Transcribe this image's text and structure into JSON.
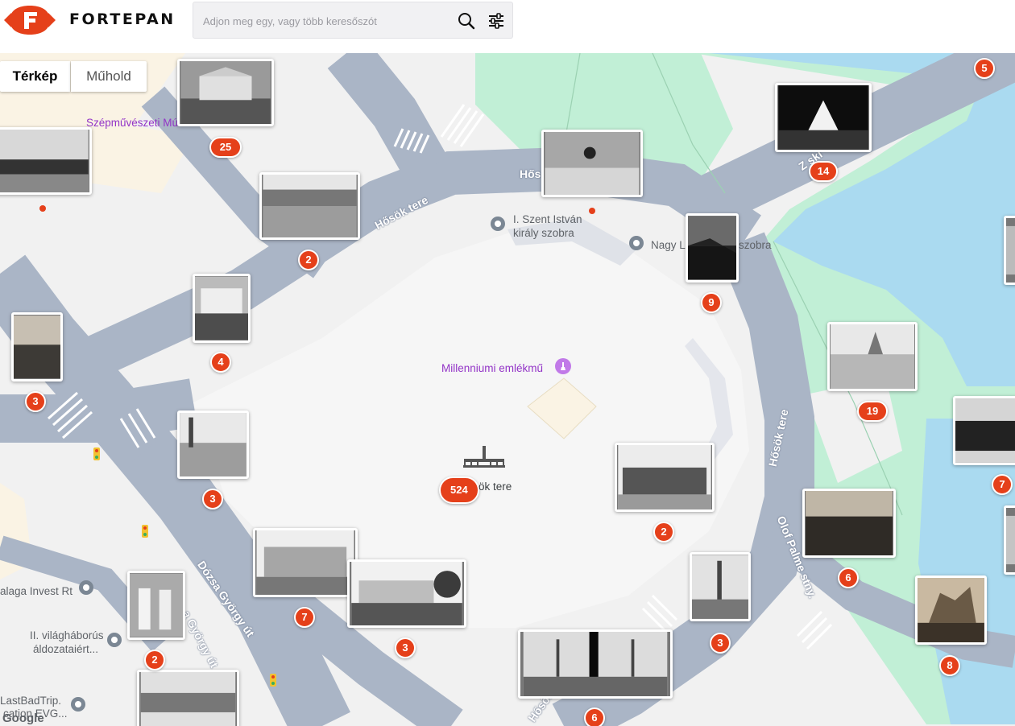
{
  "header": {
    "brand": "FORTEPAN",
    "search_placeholder": "Adjon meg egy, vagy több keresőszót"
  },
  "icons": {
    "logo": "fortepan-logo-icon",
    "search": "search-icon",
    "filters": "filter-sliders-icon",
    "place_pin": "map-pin-icon",
    "monument": "monument-icon",
    "traffic_light": "traffic-light-icon"
  },
  "map_type": {
    "map_label": "Térkép",
    "satellite_label": "Műhold",
    "selected": "Térkép"
  },
  "colors": {
    "accent": "#e5401a",
    "road": "#aab5c6",
    "park": "#c1efd6",
    "water": "#aadaf0",
    "poi_purple": "#9334c7"
  },
  "places": {
    "museum": "Szépművészeti Mú",
    "saint_stephen_line1": "I. Szent István",
    "saint_stephen_line2": "király szobra",
    "nagy_l_statue": "Nagy L",
    "nagy_l_statue_end": "szobra",
    "millennium": "Millenniumi emlékmű",
    "square": "Hősök tere",
    "balaga": "alaga Invest Rt",
    "ww2_line1": "II. világháborús",
    "ww2_line2": "áldozataiért...",
    "lastbad_line1": "LastBadTrip.",
    "lastbad_line2": "cation EVG..."
  },
  "roads": {
    "hosok_tere_1": "Hősök tere",
    "hosok_tere_2": "Hős",
    "hosok_tere_3": "Hősök tere",
    "dozsa_1": "Dózsa György út",
    "dozsa_2": "a György út",
    "olof_palme": "Olof Palme stny.",
    "zichy": "Z ski",
    "hosok_bottom": "Hősök t"
  },
  "clusters": [
    {
      "count": "25"
    },
    {
      "count": "2"
    },
    {
      "count": "4"
    },
    {
      "count": "3"
    },
    {
      "count": "3"
    },
    {
      "count": "7"
    },
    {
      "count": "3"
    },
    {
      "count": "2"
    },
    {
      "count": "524"
    },
    {
      "count": "2"
    },
    {
      "count": "9"
    },
    {
      "count": "14"
    },
    {
      "count": "5"
    },
    {
      "count": "19"
    },
    {
      "count": "7"
    },
    {
      "count": "6"
    },
    {
      "count": "8"
    },
    {
      "count": "3"
    },
    {
      "count": "6"
    }
  ],
  "attribution": "Google"
}
